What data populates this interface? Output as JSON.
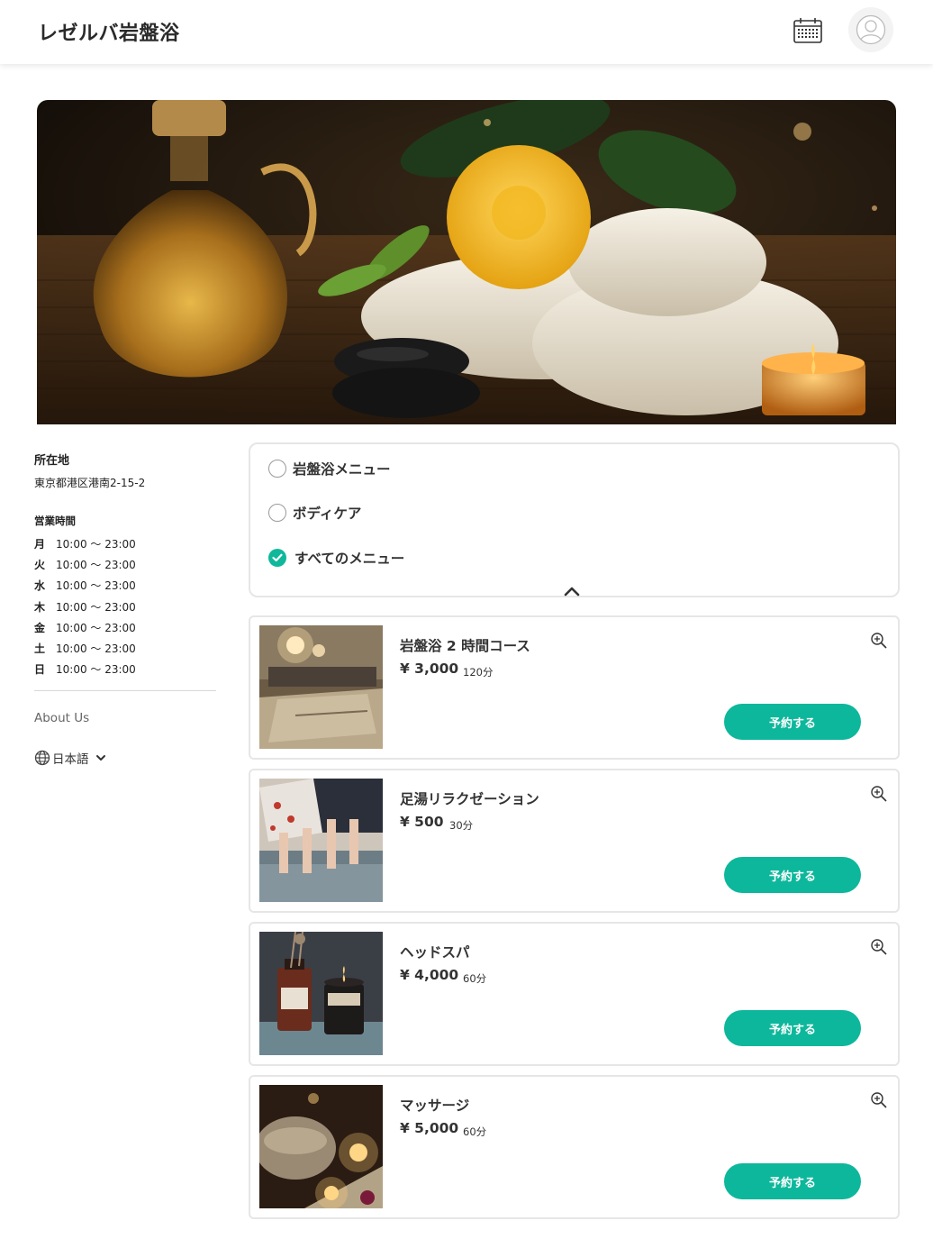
{
  "header": {
    "brand": "レゼルバ岩盤浴",
    "calendar_icon": "calendar-icon",
    "account_icon": "user-icon"
  },
  "sidebar": {
    "location_title": "所在地",
    "address": "東京都港区港南2-15-2",
    "hours_title": "営業時間",
    "hours": [
      {
        "day": "月",
        "time": "10:00 〜 23:00"
      },
      {
        "day": "火",
        "time": "10:00 〜 23:00"
      },
      {
        "day": "水",
        "time": "10:00 〜 23:00"
      },
      {
        "day": "木",
        "time": "10:00 〜 23:00"
      },
      {
        "day": "金",
        "time": "10:00 〜 23:00"
      },
      {
        "day": "土",
        "time": "10:00 〜 23:00"
      },
      {
        "day": "日",
        "time": "10:00 〜 23:00"
      }
    ],
    "about": "About Us",
    "language": "日本語"
  },
  "filter": {
    "options": [
      {
        "label": "岩盤浴メニュー",
        "selected": false
      },
      {
        "label": "ボディケア",
        "selected": false
      },
      {
        "label": "すべてのメニュー",
        "selected": true
      }
    ]
  },
  "menu": [
    {
      "name": "岩盤浴 2 時間コース",
      "price": "¥ 3,000",
      "duration": "120分",
      "button": "予約する"
    },
    {
      "name": "足湯リラクゼーション",
      "price": "¥ 500",
      "duration": "30分",
      "button": "予約する"
    },
    {
      "name": "ヘッドスパ",
      "price": "¥ 4,000",
      "duration": "60分",
      "button": "予約する"
    },
    {
      "name": "マッサージ",
      "price": "¥ 5,000",
      "duration": "60分",
      "button": "予約する"
    }
  ],
  "colors": {
    "accent": "#0db79b",
    "border": "#e6e6e6"
  }
}
